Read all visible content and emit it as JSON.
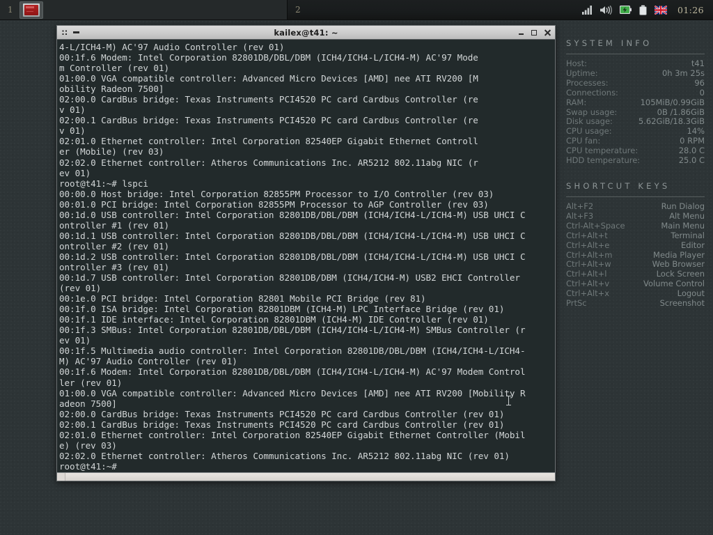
{
  "panel": {
    "workspaces": [
      {
        "number": "1",
        "active": true,
        "task_icon": "terminal-window-icon"
      },
      {
        "number": "2",
        "active": false
      }
    ],
    "tray": {
      "icons": [
        "signal-bars-icon",
        "volume-speaker-icon",
        "battery-charging-icon",
        "battery-icon",
        "keyboard-layout-uk-flag-icon"
      ],
      "clock": "01:26"
    }
  },
  "window": {
    "title": "kailex@t41: ~",
    "menu_icon": "grip-dots-icon",
    "dash_icon": "dash-icon",
    "buttons": {
      "minimize": "minimize-button",
      "maximize": "maximize-button",
      "close": "close-button"
    },
    "terminal_text": "4-L/ICH4-M) AC'97 Audio Controller (rev 01)\n00:1f.6 Modem: Intel Corporation 82801DB/DBL/DBM (ICH4/ICH4-L/ICH4-M) AC'97 Mode\nm Controller (rev 01)\n01:00.0 VGA compatible controller: Advanced Micro Devices [AMD] nee ATI RV200 [M\nobility Radeon 7500]\n02:00.0 CardBus bridge: Texas Instruments PCI4520 PC card Cardbus Controller (re\nv 01)\n02:00.1 CardBus bridge: Texas Instruments PCI4520 PC card Cardbus Controller (re\nv 01)\n02:01.0 Ethernet controller: Intel Corporation 82540EP Gigabit Ethernet Controll\ner (Mobile) (rev 03)\n02:02.0 Ethernet controller: Atheros Communications Inc. AR5212 802.11abg NIC (r\nev 01)\nroot@t41:~# lspci\n00:00.0 Host bridge: Intel Corporation 82855PM Processor to I/O Controller (rev 03)\n00:01.0 PCI bridge: Intel Corporation 82855PM Processor to AGP Controller (rev 03)\n00:1d.0 USB controller: Intel Corporation 82801DB/DBL/DBM (ICH4/ICH4-L/ICH4-M) USB UHCI C\nontroller #1 (rev 01)\n00:1d.1 USB controller: Intel Corporation 82801DB/DBL/DBM (ICH4/ICH4-L/ICH4-M) USB UHCI C\nontroller #2 (rev 01)\n00:1d.2 USB controller: Intel Corporation 82801DB/DBL/DBM (ICH4/ICH4-L/ICH4-M) USB UHCI C\nontroller #3 (rev 01)\n00:1d.7 USB controller: Intel Corporation 82801DB/DBM (ICH4/ICH4-M) USB2 EHCI Controller\n(rev 01)\n00:1e.0 PCI bridge: Intel Corporation 82801 Mobile PCI Bridge (rev 81)\n00:1f.0 ISA bridge: Intel Corporation 82801DBM (ICH4-M) LPC Interface Bridge (rev 01)\n00:1f.1 IDE interface: Intel Corporation 82801DBM (ICH4-M) IDE Controller (rev 01)\n00:1f.3 SMBus: Intel Corporation 82801DB/DBL/DBM (ICH4/ICH4-L/ICH4-M) SMBus Controller (r\nev 01)\n00:1f.5 Multimedia audio controller: Intel Corporation 82801DB/DBL/DBM (ICH4/ICH4-L/ICH4-\nM) AC'97 Audio Controller (rev 01)\n00:1f.6 Modem: Intel Corporation 82801DB/DBL/DBM (ICH4/ICH4-L/ICH4-M) AC'97 Modem Control\nler (rev 01)\n01:00.0 VGA compatible controller: Advanced Micro Devices [AMD] nee ATI RV200 [Mobility R\nadeon 7500]\n02:00.0 CardBus bridge: Texas Instruments PCI4520 PC card Cardbus Controller (rev 01)\n02:00.1 CardBus bridge: Texas Instruments PCI4520 PC card Cardbus Controller (rev 01)\n02:01.0 Ethernet controller: Intel Corporation 82540EP Gigabit Ethernet Controller (Mobil\ne) (rev 03)\n02:02.0 Ethernet controller: Atheros Communications Inc. AR5212 802.11abg NIC (rev 01)\nroot@t41:~#"
  },
  "conky": {
    "system_info": {
      "heading": "SYSTEM INFO",
      "rows": [
        {
          "label": "Host:",
          "value": "t41"
        },
        {
          "label": "Uptime:",
          "value": "0h 3m 25s"
        },
        {
          "label": "Processes:",
          "value": "96"
        },
        {
          "label": "Connections:",
          "value": "0"
        },
        {
          "label": "RAM:",
          "value": "105MiB/0.99GiB"
        },
        {
          "label": "Swap usage:",
          "value": "0B /1.86GiB"
        },
        {
          "label": "Disk usage:",
          "value": "5.62GiB/18.3GiB"
        },
        {
          "label": "CPU usage:",
          "value": "14%"
        },
        {
          "label": "CPU fan:",
          "value": "0 RPM"
        },
        {
          "label": "CPU temperature:",
          "value": "28.0 C"
        },
        {
          "label": "HDD temperature:",
          "value": "25.0 C"
        }
      ]
    },
    "shortcut_keys": {
      "heading": "SHORTCUT KEYS",
      "rows": [
        {
          "label": "Alt+F2",
          "value": "Run Dialog"
        },
        {
          "label": "Alt+F3",
          "value": "Alt Menu"
        },
        {
          "label": "Ctrl-Alt+Space",
          "value": "Main Menu"
        },
        {
          "label": "Ctrl+Alt+t",
          "value": "Terminal"
        },
        {
          "label": "Ctrl+Alt+e",
          "value": "Editor"
        },
        {
          "label": "Ctrl+Alt+m",
          "value": "Media Player"
        },
        {
          "label": "Ctrl+Alt+w",
          "value": "Web Browser"
        },
        {
          "label": "Ctrl+Alt+l",
          "value": "Lock Screen"
        },
        {
          "label": "Ctrl+Alt+v",
          "value": "Volume Control"
        },
        {
          "label": "Ctrl+Alt+x",
          "value": "Logout"
        },
        {
          "label": "PrtSc",
          "value": "Screenshot"
        }
      ]
    }
  },
  "colors": {
    "desktop_bg": "#2d3436",
    "panel_bg": "#191c1d",
    "terminal_bg": "#222a2b",
    "terminal_fg": "#d2d6d7",
    "conky_fg": "#7f8889",
    "clock_fg": "#b9b39a"
  }
}
